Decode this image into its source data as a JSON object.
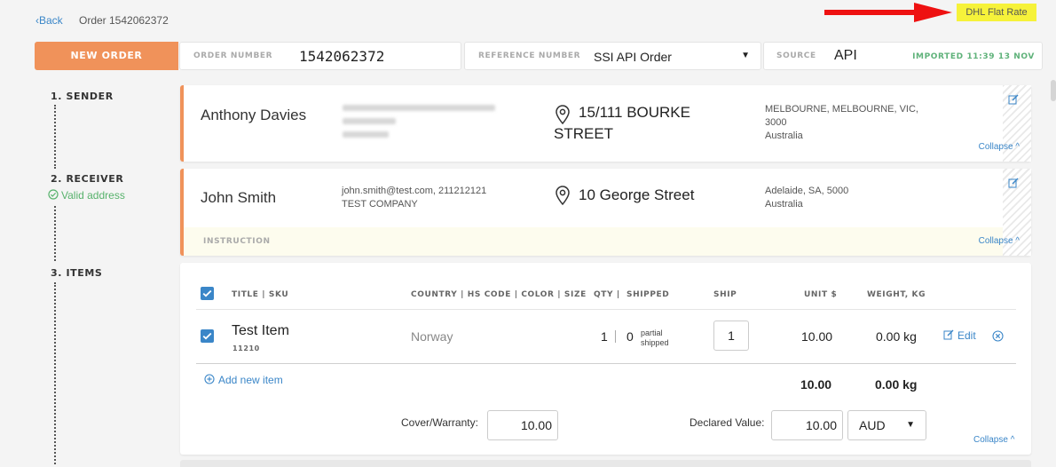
{
  "nav": {
    "back_label": "‹Back",
    "order_title": "Order 1542062372"
  },
  "tag": {
    "label": "DHL Flat Rate",
    "highlight_color": "#f6f23a"
  },
  "header": {
    "new_order_label": "NEW ORDER",
    "order_number_label": "ORDER NUMBER",
    "order_number_value": "1542062372",
    "reference_label": "REFERENCE NUMBER",
    "reference_value": "SSI API Order",
    "source_label": "SOURCE",
    "source_value": "API",
    "imported_text": "IMPORTED 11:39 13 Nov"
  },
  "steps": {
    "sender": "1. SENDER",
    "receiver": "2. RECEIVER",
    "valid_address": "Valid address",
    "items": "3. ITEMS"
  },
  "sender": {
    "name": "Anthony Davies",
    "street": "15/111 BOURKE STREET",
    "city_line1": "MELBOURNE, MELBOURNE, VIC,",
    "city_line2": "3000",
    "country": "Australia",
    "collapse_label": "Collapse ^"
  },
  "receiver": {
    "name": "John Smith",
    "contact_line1": "john.smith@test.com, 211212121",
    "contact_line2": "TEST COMPANY",
    "street": "10 George Street",
    "city_line1": "Adelaide, SA, 5000",
    "country": "Australia",
    "instruction_label": "INSTRUCTION",
    "collapse_label": "Collapse ^"
  },
  "items": {
    "columns": {
      "title": "TITLE | SKU",
      "country": "COUNTRY | HS CODE | COLOR | SIZE",
      "qty": "QTY |",
      "shipped": "SHIPPED",
      "ship": "SHIP",
      "unit": "UNIT $",
      "weight": "WEIGHT, KG"
    },
    "rows": [
      {
        "title": "Test Item",
        "sku": "11210",
        "country": "Norway",
        "qty": "1",
        "shipped": "0",
        "shipped_note": "partial shipped",
        "ship": "1",
        "unit": "10.00",
        "weight": "0.00 kg",
        "edit_label": "Edit"
      }
    ],
    "add_label": "Add new item",
    "total_unit": "10.00",
    "total_weight": "0.00 kg",
    "cover_label": "Cover/Warranty:",
    "cover_value": "10.00",
    "declared_label": "Declared Value:",
    "declared_value": "10.00",
    "currency": "AUD",
    "collapse_label": "Collapse ^"
  },
  "colors": {
    "accent": "#f0925a",
    "link": "#3a86c8",
    "success": "#57b26c"
  }
}
